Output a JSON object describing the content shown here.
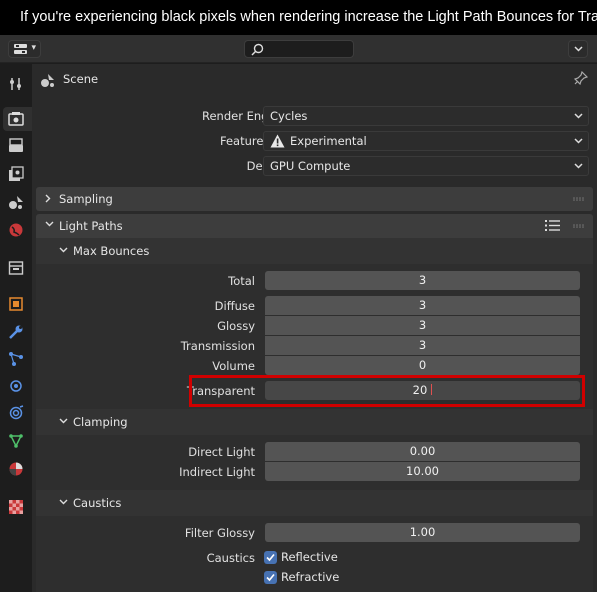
{
  "caption": "If you're experiencing black pixels when rendering increase the Light Path Bounces for Transparent",
  "header": {
    "editor_type_icon": "properties-editor-icon",
    "search_placeholder": "",
    "options_icon": "chevron-down-icon"
  },
  "tabs": [
    {
      "name": "tool",
      "icon": "tool-icon"
    },
    {
      "name": "render",
      "icon": "render-icon",
      "active": true
    },
    {
      "name": "output",
      "icon": "output-icon"
    },
    {
      "name": "view-layer",
      "icon": "view-layer-icon"
    },
    {
      "name": "scene",
      "icon": "scene-icon"
    },
    {
      "name": "world",
      "icon": "world-icon"
    },
    {
      "name": "collection",
      "icon": "collection-icon"
    },
    {
      "name": "object",
      "icon": "object-icon"
    },
    {
      "name": "modifiers",
      "icon": "wrench-icon"
    },
    {
      "name": "particles",
      "icon": "particles-icon"
    },
    {
      "name": "physics",
      "icon": "physics-icon"
    },
    {
      "name": "constraints",
      "icon": "constraints-icon"
    },
    {
      "name": "data",
      "icon": "mesh-data-icon"
    },
    {
      "name": "material",
      "icon": "material-icon"
    },
    {
      "name": "texture",
      "icon": "texture-icon"
    }
  ],
  "context": {
    "label": "Scene"
  },
  "render": {
    "engine_label": "Render Engine",
    "engine_value": "Cycles",
    "feature_set_label": "Feature Set",
    "feature_set_value": "Experimental",
    "device_label": "Device",
    "device_value": "GPU Compute"
  },
  "panels": {
    "sampling": "Sampling",
    "light_paths": "Light Paths",
    "max_bounces": "Max Bounces",
    "clamping": "Clamping",
    "caustics": "Caustics"
  },
  "bounces": {
    "total_label": "Total",
    "total": "3",
    "diffuse_label": "Diffuse",
    "diffuse": "3",
    "glossy_label": "Glossy",
    "glossy": "3",
    "transmission_label": "Transmission",
    "transmission": "3",
    "volume_label": "Volume",
    "volume": "0",
    "transparent_label": "Transparent",
    "transparent": "20"
  },
  "clamping": {
    "direct_label": "Direct Light",
    "direct": "0.00",
    "indirect_label": "Indirect Light",
    "indirect": "10.00"
  },
  "caustics": {
    "filter_label": "Filter Glossy",
    "filter": "1.00",
    "caustics_label": "Caustics",
    "reflective_label": "Reflective",
    "reflective": true,
    "refractive_label": "Refractive",
    "refractive": true
  },
  "colors": {
    "highlight": "#d10000",
    "checkbox": "#4772b3",
    "field": "#545454"
  }
}
